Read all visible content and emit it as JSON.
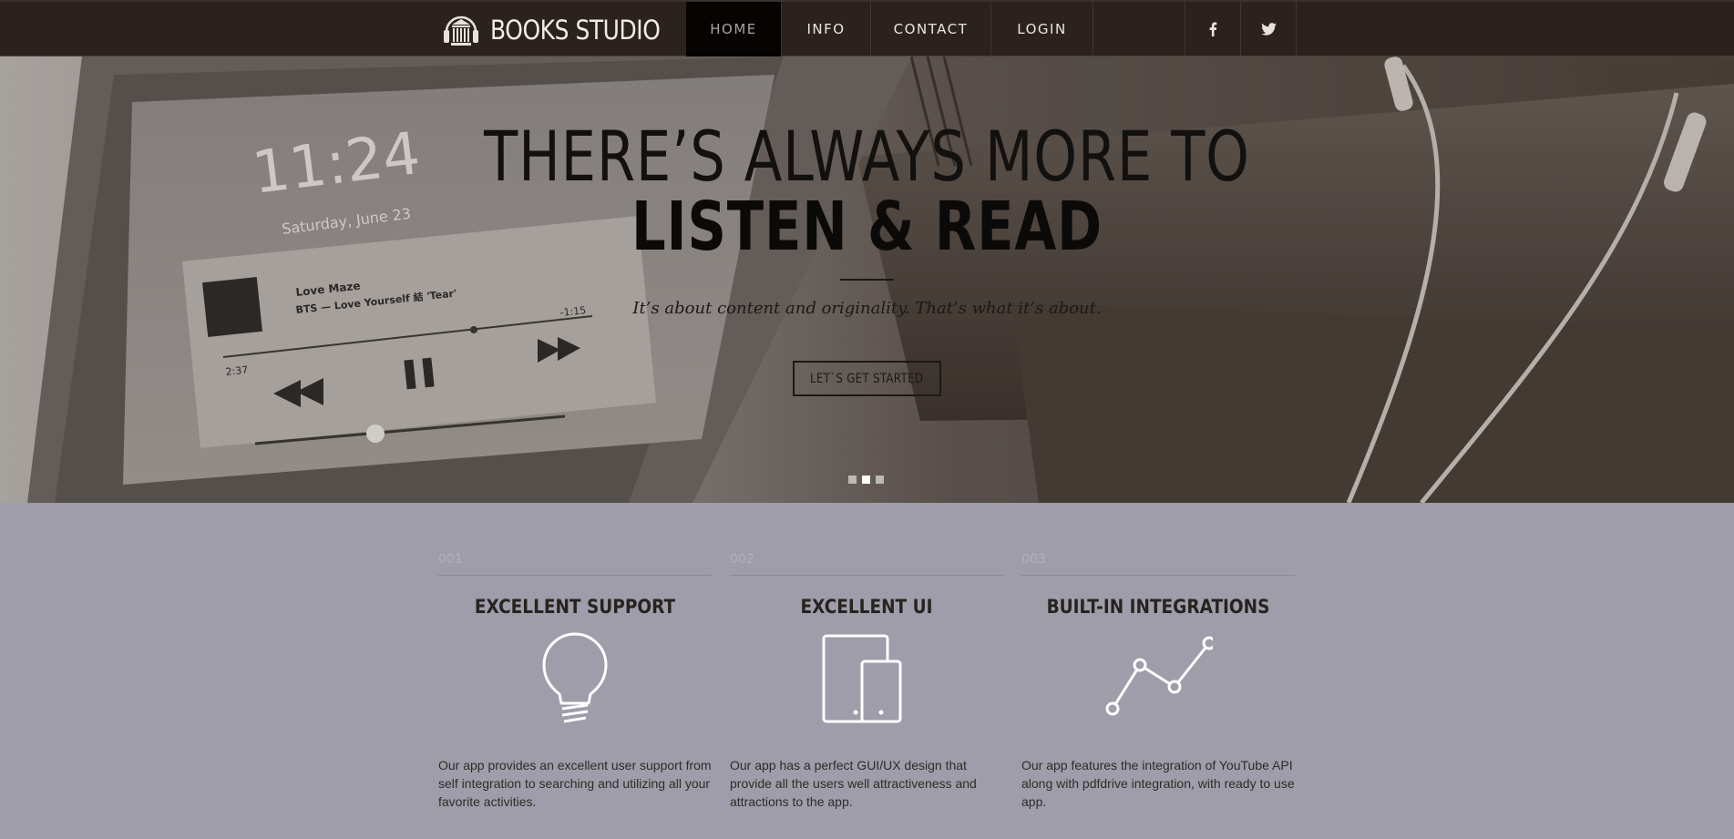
{
  "brand": {
    "name": "BOOKS STUDIO",
    "icon": "library-headphones-icon"
  },
  "nav": {
    "items": [
      {
        "label": "HOME",
        "active": true
      },
      {
        "label": "INFO",
        "active": false
      },
      {
        "label": "CONTACT",
        "active": false
      },
      {
        "label": "LOGIN",
        "active": false
      }
    ],
    "social": [
      {
        "icon": "facebook-icon"
      },
      {
        "icon": "twitter-icon"
      }
    ]
  },
  "hero": {
    "title_line1": "THERE’S ALWAYS MORE TO",
    "title_line2": "LISTEN & READ",
    "subtitle": "It’s about content and originality. That’s what it’s about.",
    "cta_label": "LET`S GET STARTED",
    "background_phone": {
      "time": "11:24",
      "date": "Saturday, June 23",
      "track_title": "Love Maze",
      "track_artist": "BTS — Love Yourself 結 'Tear'",
      "elapsed": "2:37",
      "remaining": "-1:15"
    },
    "slides": {
      "count": 3,
      "active_index": 1
    }
  },
  "features": [
    {
      "number": "001",
      "title": "EXCELLENT SUPPORT",
      "icon": "lightbulb-icon",
      "text": "Our app provides an excellent user support from self integration to searching and utilizing all your favorite activities."
    },
    {
      "number": "002",
      "title": "EXCELLENT UI",
      "icon": "devices-icon",
      "text": "Our app has a perfect GUI/UX design that provide all the users well attractiveness and attractions to the app."
    },
    {
      "number": "003",
      "title": "BUILT-IN INTEGRATIONS",
      "icon": "line-graph-icon",
      "text": "Our app features the integration of YouTube API along with pdfdrive integration, with ready to use app."
    }
  ],
  "colors": {
    "navbar_bg": "#2b221d",
    "nav_active_bg": "#050403",
    "page_bg": "#9f9da9",
    "hero_text": "#131110"
  }
}
